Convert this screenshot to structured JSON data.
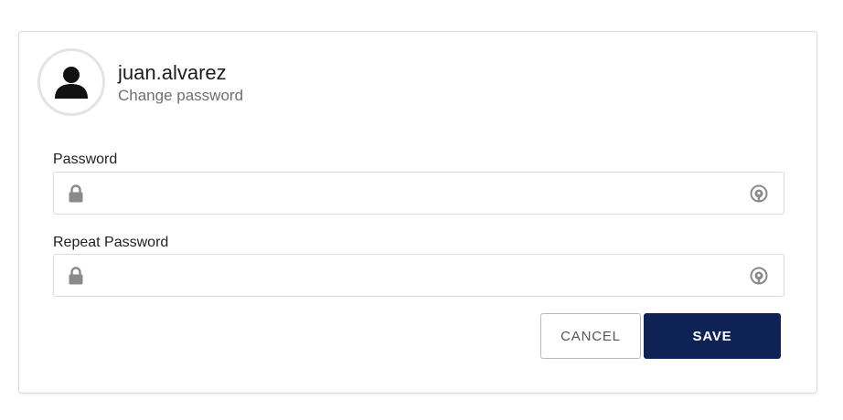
{
  "profile": {
    "username": "juan.alvarez",
    "subtitle": "Change password",
    "avatar_icon": "user-silhouette-icon"
  },
  "form": {
    "password": {
      "label": "Password",
      "value": "",
      "leading_icon": "lock-icon",
      "trailing_icon": "reveal-password-icon"
    },
    "repeat_password": {
      "label": "Repeat Password",
      "value": "",
      "leading_icon": "lock-icon",
      "trailing_icon": "reveal-password-icon"
    }
  },
  "actions": {
    "cancel_label": "CANCEL",
    "save_label": "SAVE"
  },
  "colors": {
    "primary": "#0f2255",
    "border": "#dcdcdc",
    "icon_gray": "#8a8a8a"
  }
}
